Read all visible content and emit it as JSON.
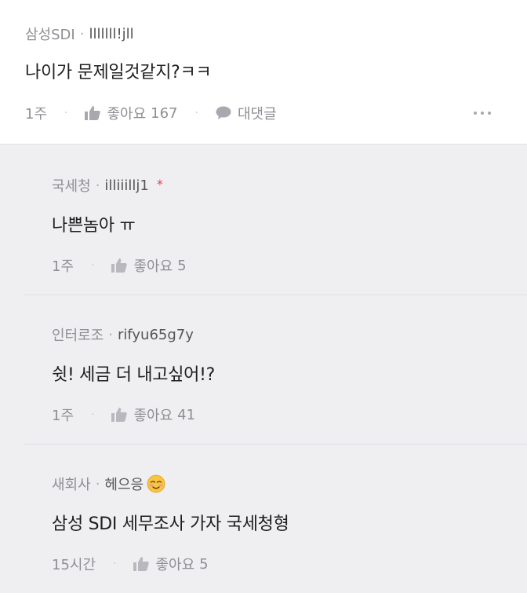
{
  "top_comment": {
    "author": "삼성SDI",
    "nickname": "lllllll!jll",
    "text": "나이가 문제일것같지?ㅋㅋ",
    "time": "1주",
    "like_label": "좋아요",
    "like_count": "167",
    "reply_label": "대댓글",
    "more_icon": "more-dots-icon"
  },
  "replies": [
    {
      "author": "국세청",
      "nickname": "illiiillj1",
      "star": "*",
      "text": "나쁜놈아 ㅠ",
      "time": "1주",
      "like_label": "좋아요",
      "like_count": "5"
    },
    {
      "author": "인터로조",
      "nickname": "rifyu65g7y",
      "text": "쉿! 세금 더 내고싶어!?",
      "time": "1주",
      "like_label": "좋아요",
      "like_count": "41"
    },
    {
      "author": "새회사",
      "nickname": "헤으응",
      "nickname_emoji": "smiling-face-emoji",
      "text": "삼성 SDI 세무조사 가자 국세청형",
      "time": "15시간",
      "like_label": "좋아요",
      "like_count": "5"
    }
  ],
  "colors": {
    "top_background": "#ffffff",
    "reply_background": "#efeff1",
    "meta_text": "#8e8e94",
    "star": "#e8434b"
  }
}
